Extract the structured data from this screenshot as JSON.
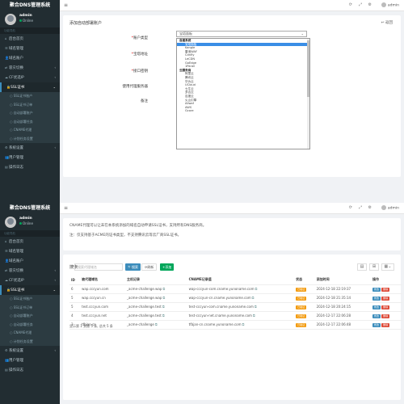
{
  "app": {
    "title": "聚合DNS管理系统"
  },
  "user": {
    "name": "admin",
    "status": "Online"
  },
  "nav": {
    "section": "功能导航",
    "items": [
      {
        "label": "后台首页",
        "icon": "home-icon"
      },
      {
        "label": "域名管理",
        "icon": "list-icon"
      },
      {
        "label": "域名账户",
        "icon": "user-icon"
      },
      {
        "label": "容灾切换",
        "icon": "shuffle-icon",
        "arrow": "‹"
      },
      {
        "label": "CF优选IP",
        "icon": "cloud-icon",
        "arrow": "‹"
      },
      {
        "label": "SSL证书",
        "icon": "lock-icon",
        "arrow": "⌄",
        "active": true
      }
    ],
    "subitems": [
      "SSL证书账户",
      "SSL证书订单",
      "自动部署账户",
      "自动部署任务",
      "CNAME代理",
      "计划任务设置"
    ],
    "bottom": [
      {
        "label": "系统设置",
        "icon": "gear-icon",
        "arrow": "‹"
      },
      {
        "label": "用户管理",
        "icon": "users-icon"
      },
      {
        "label": "操作日志",
        "icon": "file-icon"
      }
    ]
  },
  "topbar": {
    "menu_icon": "≡",
    "user": "admin"
  },
  "form": {
    "heading": "添加自动部署账户",
    "back": "返回",
    "labels": [
      "账户类型",
      "宝塔地址",
      "接口密钥",
      "使用代理服务器",
      "备注"
    ],
    "select_value": "宝塔面板",
    "options": [
      {
        "label": "自建系统",
        "group": true
      },
      {
        "label": "宝塔面板",
        "selected": true
      },
      {
        "label": "Kangle"
      },
      {
        "label": "雷池WAF"
      },
      {
        "label": "Cdnfly"
      },
      {
        "label": "LeCDN"
      },
      {
        "label": "GoEdge"
      },
      {
        "label": "1Panel"
      },
      {
        "label": "云服务商",
        "group": true
      },
      {
        "label": "阿里云"
      },
      {
        "label": "腾讯云"
      },
      {
        "label": "华为云"
      },
      {
        "label": "UCloud"
      },
      {
        "label": "七牛云"
      },
      {
        "label": "多吉云"
      },
      {
        "label": "百度云"
      },
      {
        "label": "火山引擎"
      },
      {
        "label": "Allwaf"
      },
      {
        "label": "AWS"
      },
      {
        "label": "Gcore"
      }
    ]
  },
  "notice": {
    "line1": "CNAME代理可以让未在本系统添加的域名自动申请SSL证书，支持所有DNS服务商。",
    "line2": "注：仅支持基于ACME的证书类型，不支持腾讯云等云厂商SSL证书。"
  },
  "toolbar": {
    "search_label": "搜索",
    "search_placeholder": "搜索代理域名",
    "search_btn": "搜索",
    "refresh_btn": "刷新",
    "add_btn": "添加"
  },
  "table": {
    "headers": [
      "ID",
      "被代理域名",
      "主机记录",
      "CNAME记录值",
      "状态",
      "添加时间",
      "操作"
    ],
    "rows": [
      {
        "id": "6",
        "domain": "wap.cccyun.com",
        "host": "_acme-challenge.wap",
        "cname": "wap-cccyun-com.cname.yunoname.com",
        "status": "已验证",
        "time": "2024-12-18 22:19:37"
      },
      {
        "id": "5",
        "domain": "wap.cccyun.cn",
        "host": "_acme-challenge.wap",
        "cname": "wap-cccyun-cn.cname.yunoname.com",
        "status": "已验证",
        "time": "2024-12-18 21:35:14"
      },
      {
        "id": "5",
        "domain": "test.cccyun.com",
        "host": "_acme-challenge.test",
        "cname": "test-cccyun-com.cname.yunoname.com",
        "status": "已验证",
        "time": "2024-12-18 20:24:15"
      },
      {
        "id": "4",
        "domain": "test.cccyun.net",
        "host": "_acme-challenge.test",
        "cname": "test-cccyun-net.cname.yunoname.com",
        "status": "已验证",
        "time": "2024-12-17 22:06:28"
      },
      {
        "id": "3",
        "domain": "tfbjan.cn",
        "host": "_acme-challenge",
        "cname": "tfbjan-cn.cname.yunoname.com",
        "status": "已验证",
        "time": "2024-12-17 22:06:48"
      }
    ],
    "edit": "修改",
    "delete": "删除"
  },
  "pager": "显示第 1 到第 5 条, 总共 5 条"
}
